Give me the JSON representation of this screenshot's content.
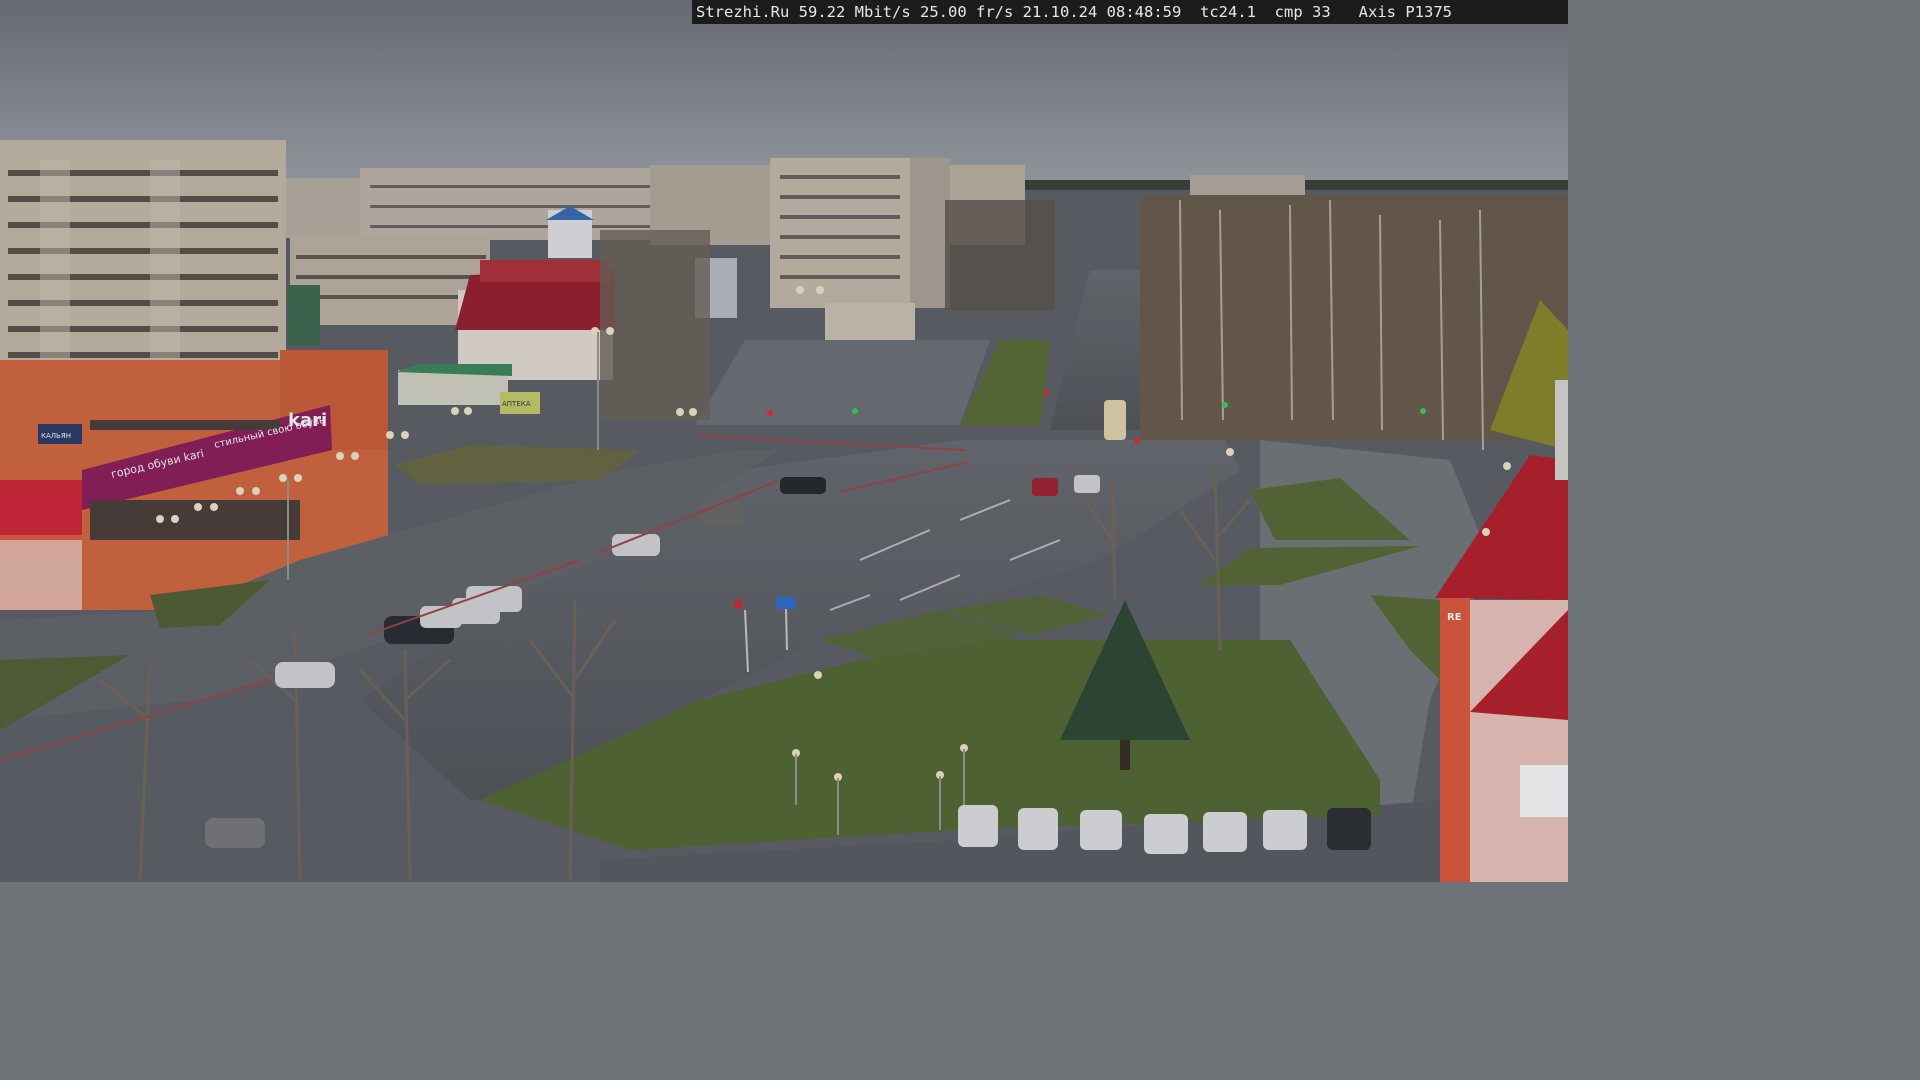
{
  "overlay": {
    "site": "Strezhi.Ru",
    "bitrate": "59.22 Mbit/s",
    "framerate": "25.00 fr/s",
    "date": "21.10.24",
    "time": "08:48:59",
    "tc": "tc24.1",
    "cmp": "cmp 33",
    "camera": "Axis P1375"
  },
  "signage": {
    "store_logo": "kari",
    "store_banner": "город обуви kari",
    "store_banner_2": "стильный свою обувь",
    "left_sign": "КАЛЬЯН",
    "tower_sign": "RE",
    "sign_pharmacy": "АПТЕКА"
  },
  "colors": {
    "sky": "#8a9099",
    "asphalt": "#5d6266",
    "grass": "#596b3a",
    "kari_banner": "#8e1e5a",
    "red_roof": "#b8202b"
  }
}
